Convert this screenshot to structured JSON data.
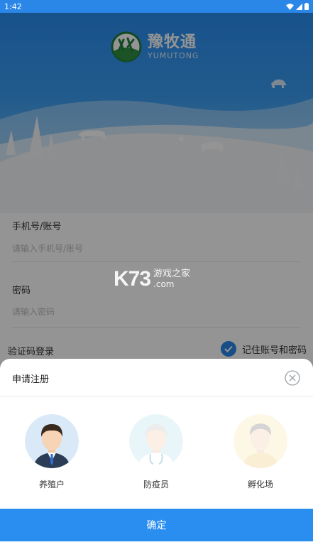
{
  "status_bar": {
    "time": "1:42"
  },
  "header": {
    "app_name": "豫牧通",
    "app_sub": "YUMUTONG"
  },
  "form": {
    "phone_label": "手机号/账号",
    "phone_placeholder": "请输入手机号/账号",
    "password_label": "密码",
    "password_placeholder": "请输入密码",
    "sms_login": "验证码登录",
    "remember_label": "记住账号和密码",
    "remember_checked": true
  },
  "watermark": {
    "big": "K73",
    "line1": "游戏之家",
    "line2": ".com"
  },
  "sheet": {
    "title": "申请注册",
    "roles": [
      {
        "label": "养殖户",
        "selected": true
      },
      {
        "label": "防疫员",
        "selected": false
      },
      {
        "label": "孵化场",
        "selected": false
      }
    ],
    "confirm_label": "确定"
  },
  "colors": {
    "accent": "#2a8ef0"
  }
}
